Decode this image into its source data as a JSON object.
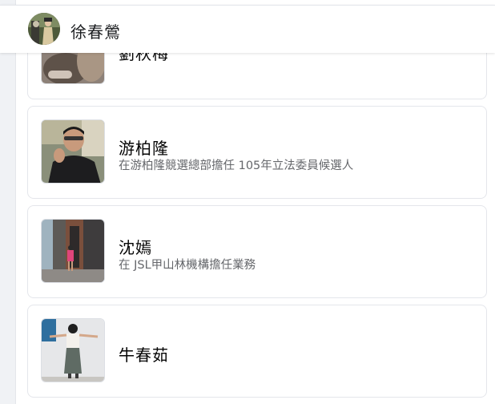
{
  "header": {
    "name": "徐春鶯"
  },
  "people": [
    {
      "name": "劉秋梅",
      "subtitle": ""
    },
    {
      "name": "游柏隆",
      "subtitle": "在游柏隆競選總部擔任 105年立法委員候選人"
    },
    {
      "name": "沈嫣",
      "subtitle": "在 JSL甲山林機構擔任業務"
    },
    {
      "name": "牛春茹",
      "subtitle": ""
    }
  ]
}
